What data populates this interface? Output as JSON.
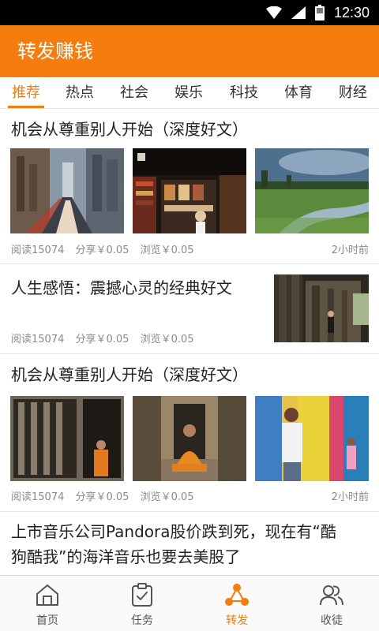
{
  "status_bar": {
    "time": "12:30"
  },
  "app_bar": {
    "title": "转发赚钱"
  },
  "tabs": [
    {
      "label": "推荐",
      "active": true
    },
    {
      "label": "热点"
    },
    {
      "label": "社会"
    },
    {
      "label": "娱乐"
    },
    {
      "label": "科技"
    },
    {
      "label": "体育"
    },
    {
      "label": "财经"
    }
  ],
  "articles": [
    {
      "title": "机会从尊重别人开始（深度好文）",
      "images": [
        "city-street-photo",
        "bookstore-photo",
        "meadow-landscape-photo"
      ],
      "reads": "阅读15074",
      "share": "分享￥0.05",
      "browse": "浏览￥0.05",
      "time": "2小时前"
    },
    {
      "title": "人生感悟：震撼心灵的经典好文",
      "images": [
        "temple-corridor-photo"
      ],
      "reads": "阅读15074",
      "share": "分享￥0.05",
      "browse": "浏览￥0.05"
    },
    {
      "title": "机会从尊重别人开始（深度好文）",
      "images": [
        "monk-window-photo",
        "monk-sitting-photo",
        "colorful-doors-photo"
      ],
      "reads": "阅读15074",
      "share": "分享￥0.05",
      "browse": "浏览￥0.05",
      "time": "2小时前"
    },
    {
      "title_line1": "上市音乐公司Pandora股价跌到死，现在有“酷",
      "title_line2": "狗酷我”的海洋音乐也要去美股了"
    }
  ],
  "bottom_nav": [
    {
      "label": "首页",
      "icon": "home-icon"
    },
    {
      "label": "任务",
      "icon": "task-icon"
    },
    {
      "label": "转发",
      "icon": "share-icon",
      "active": true
    },
    {
      "label": "收徒",
      "icon": "users-icon"
    }
  ],
  "colors": {
    "accent": "#f57c0e",
    "status_bar": "#000000",
    "text": "#222222",
    "meta": "#8a8a8a"
  }
}
